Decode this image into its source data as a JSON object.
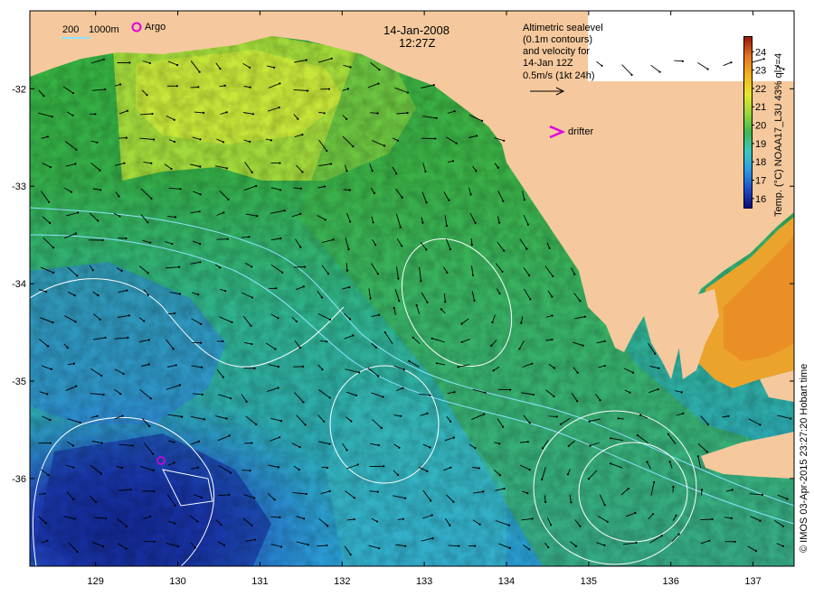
{
  "title": {
    "date": "14-Jan-2008",
    "time": "12:27Z"
  },
  "scale": {
    "depth1": "200",
    "depth2": "1000m",
    "argo_label": "Argo"
  },
  "legend_text": {
    "line1": "Altimetric sealevel",
    "line2": "(0.1m contours)",
    "line3": "and velocity for",
    "line4": "14-Jan 12Z",
    "line5": "0.5m/s (1kt 24h)",
    "drifter_label": "drifter"
  },
  "colorbar": {
    "label": "Temp. (°C) NOAA17_L3U 43% ql>=4",
    "ticks": [
      "16",
      "17",
      "18",
      "19",
      "20",
      "21",
      "22",
      "23",
      "24"
    ],
    "range": [
      15.5,
      24.8
    ],
    "colors": [
      "#0a0a78",
      "#1e50c8",
      "#2e9be6",
      "#3cc8c0",
      "#40b850",
      "#9ad83c",
      "#e6e632",
      "#f5b41e",
      "#e6781e",
      "#a01e0a"
    ]
  },
  "credit": "© IMOS 03-Apr-2015 23:27:20 Hobart time",
  "axes": {
    "x_ticks": [
      "129",
      "130",
      "131",
      "132",
      "133",
      "134",
      "135",
      "136",
      "137"
    ],
    "y_ticks": [
      "-32",
      "-33",
      "-34",
      "-35",
      "-36"
    ],
    "x_values": [
      129,
      130,
      131,
      132,
      133,
      134,
      135,
      136,
      137
    ],
    "y_values": [
      -32,
      -33,
      -34,
      -35,
      -36
    ],
    "lon_range": [
      128.2,
      137.5
    ],
    "lat_range": [
      -36.9,
      -31.2
    ]
  },
  "colors": {
    "land": "#f5c99d",
    "arrow": "#000000",
    "contour": "#ffffff",
    "isobath": "#7fd8ff",
    "marker": "#e000e0"
  }
}
